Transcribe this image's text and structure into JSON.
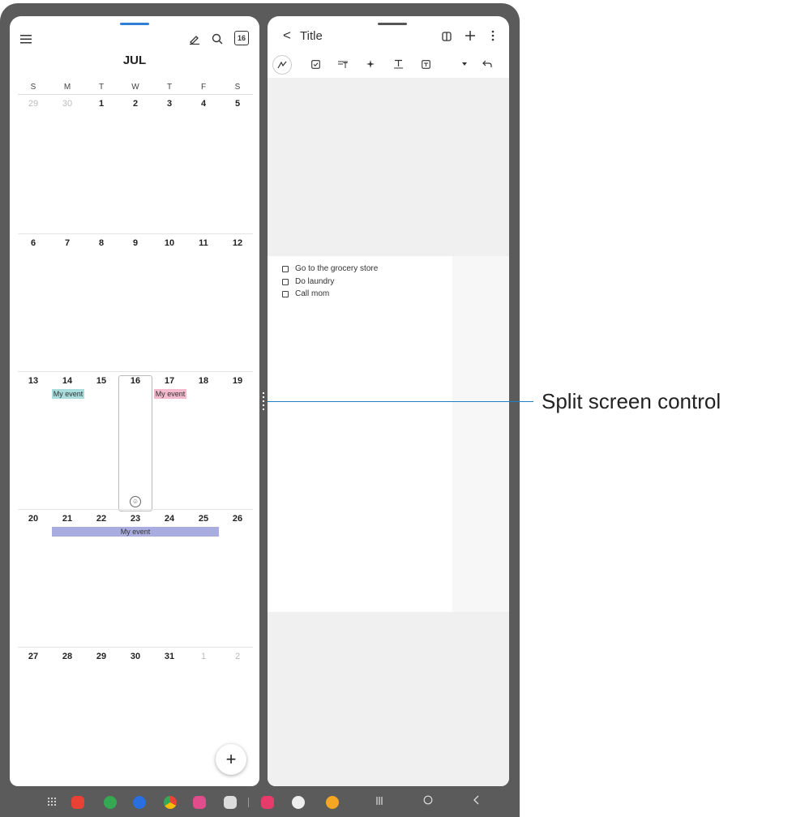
{
  "calendar": {
    "month": "JUL",
    "today_badge": "16",
    "weekdays": [
      "S",
      "M",
      "T",
      "W",
      "T",
      "F",
      "S"
    ],
    "weeks": [
      [
        "29",
        "30",
        "1",
        "2",
        "3",
        "4",
        "5"
      ],
      [
        "6",
        "7",
        "8",
        "9",
        "10",
        "11",
        "12"
      ],
      [
        "13",
        "14",
        "15",
        "16",
        "17",
        "18",
        "19"
      ],
      [
        "20",
        "21",
        "22",
        "23",
        "24",
        "25",
        "26"
      ],
      [
        "27",
        "28",
        "29",
        "30",
        "31",
        "1",
        "2"
      ]
    ],
    "events": {
      "week3_mon": "My event",
      "week3_thu": "My event",
      "week4_span": "My event"
    },
    "fab_label": "+"
  },
  "notes": {
    "back_label": "<",
    "title": "Title",
    "checklist": [
      "Go to the grocery store",
      "Do laundry",
      "Call mom"
    ]
  },
  "callout": {
    "label": "Split screen control"
  },
  "colors": {
    "accent_blue": "#2f7fd8",
    "event_teal": "#a9dcdc",
    "event_pink": "#f4b9cd",
    "event_lavender": "#a8acdf",
    "callout_line": "#1e7fc7"
  }
}
